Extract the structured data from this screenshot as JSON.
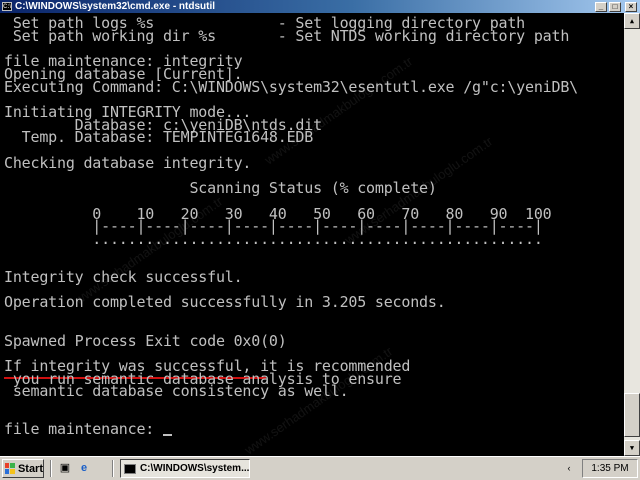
{
  "window": {
    "title": "C:\\WINDOWS\\system32\\cmd.exe - ntdsutil",
    "icon": "console-app-icon",
    "icon_glyph": "C:\\",
    "minimize_glyph": "_",
    "maximize_glyph": "□",
    "close_glyph": "×"
  },
  "console": {
    "lines": [
      " Set path logs %s              - Set logging directory path",
      " Set path working dir %s       - Set NTDS working directory path",
      "",
      "file maintenance: integrity",
      "Opening database [Current].",
      "Executing Command: C:\\WINDOWS\\system32\\esentutl.exe /g\"c:\\yeniDB\\",
      "",
      "Initiating INTEGRITY mode...",
      "        Database: c:\\yeniDB\\ntds.dit",
      "  Temp. Database: TEMPINTEG1648.EDB",
      "",
      "Checking database integrity.",
      "",
      "                     Scanning Status (% complete)",
      "",
      "          0    10   20   30   40   50   60   70   80   90  100",
      "          |----|----|----|----|----|----|----|----|----|----|",
      "          ...................................................",
      "",
      "",
      "Integrity check successful.",
      "",
      "Operation completed successfully in 3.205 seconds.",
      "",
      "",
      "Spawned Process Exit code 0x0(0)",
      "",
      "If integrity was successful, it is recommended",
      " you run semantic database analysis to ensure",
      " semantic database consistency as well.",
      "",
      "",
      "file maintenance: "
    ],
    "text_color": "#c0c0c0",
    "background_color": "#000000",
    "highlight_underline_color": "#d01010"
  },
  "watermark": {
    "text": "www.serhadmakbuloglu.com.tr"
  },
  "scrollbar": {
    "up_glyph": "▲",
    "down_glyph": "▼"
  },
  "taskbar": {
    "start_label": "Start",
    "quick_launch": [
      "show-desktop-icon",
      "internet-explorer-icon"
    ],
    "quick_launch_glyphs": [
      "▣",
      "e"
    ],
    "task_label": "C:\\WINDOWS\\system...",
    "tray_icon": "network-icon",
    "tray_glyph": "‹",
    "clock": "1:35 PM"
  }
}
